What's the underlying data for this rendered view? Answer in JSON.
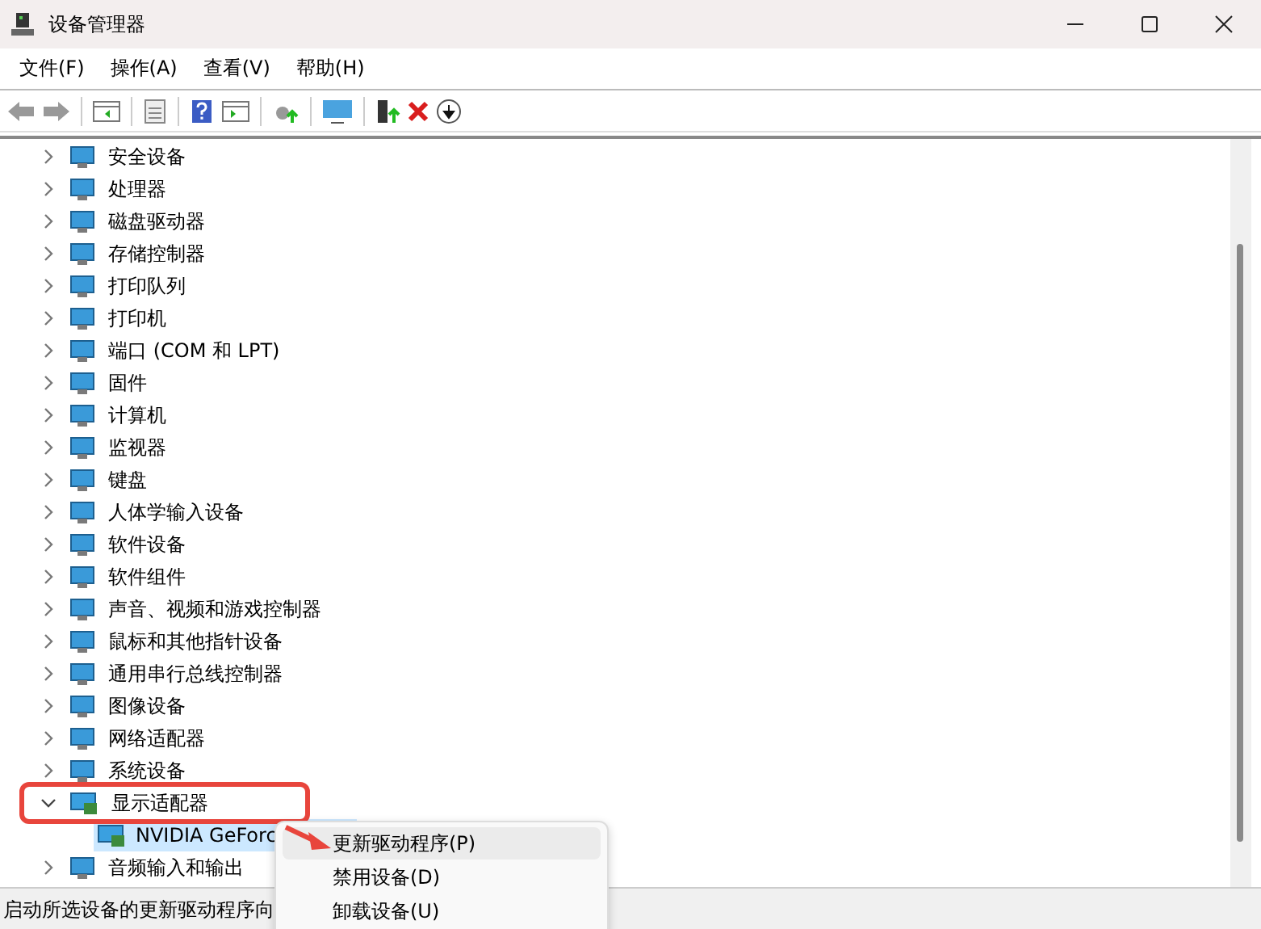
{
  "window": {
    "title": "设备管理器"
  },
  "menu_bar": [
    "文件(F)",
    "操作(A)",
    "查看(V)",
    "帮助(H)"
  ],
  "tree": [
    {
      "label": "安全设备",
      "expanded": false
    },
    {
      "label": "处理器",
      "expanded": false
    },
    {
      "label": "磁盘驱动器",
      "expanded": false
    },
    {
      "label": "存储控制器",
      "expanded": false
    },
    {
      "label": "打印队列",
      "expanded": false
    },
    {
      "label": "打印机",
      "expanded": false
    },
    {
      "label": "端口 (COM 和 LPT)",
      "expanded": false
    },
    {
      "label": "固件",
      "expanded": false
    },
    {
      "label": "计算机",
      "expanded": false
    },
    {
      "label": "监视器",
      "expanded": false
    },
    {
      "label": "键盘",
      "expanded": false
    },
    {
      "label": "人体学输入设备",
      "expanded": false
    },
    {
      "label": "软件设备",
      "expanded": false
    },
    {
      "label": "软件组件",
      "expanded": false
    },
    {
      "label": "声音、视频和游戏控制器",
      "expanded": false
    },
    {
      "label": "鼠标和其他指针设备",
      "expanded": false
    },
    {
      "label": "通用串行总线控制器",
      "expanded": false
    },
    {
      "label": "图像设备",
      "expanded": false
    },
    {
      "label": "网络适配器",
      "expanded": false
    },
    {
      "label": "系统设备",
      "expanded": false
    },
    {
      "label": "显示适配器",
      "expanded": true,
      "highlighted": true,
      "children": [
        {
          "label": "NVIDIA GeForc",
          "selected": true
        }
      ]
    },
    {
      "label": "音频输入和输出",
      "expanded": false
    }
  ],
  "status_bar": "启动所选设备的更新驱动程序向",
  "context_menu": {
    "pointer_arrow": true,
    "items": [
      {
        "label": "更新驱动程序(P)",
        "selected": true
      },
      {
        "label": "禁用设备(D)",
        "selected": false
      },
      {
        "label": "卸载设备(U)",
        "selected": false
      }
    ]
  }
}
